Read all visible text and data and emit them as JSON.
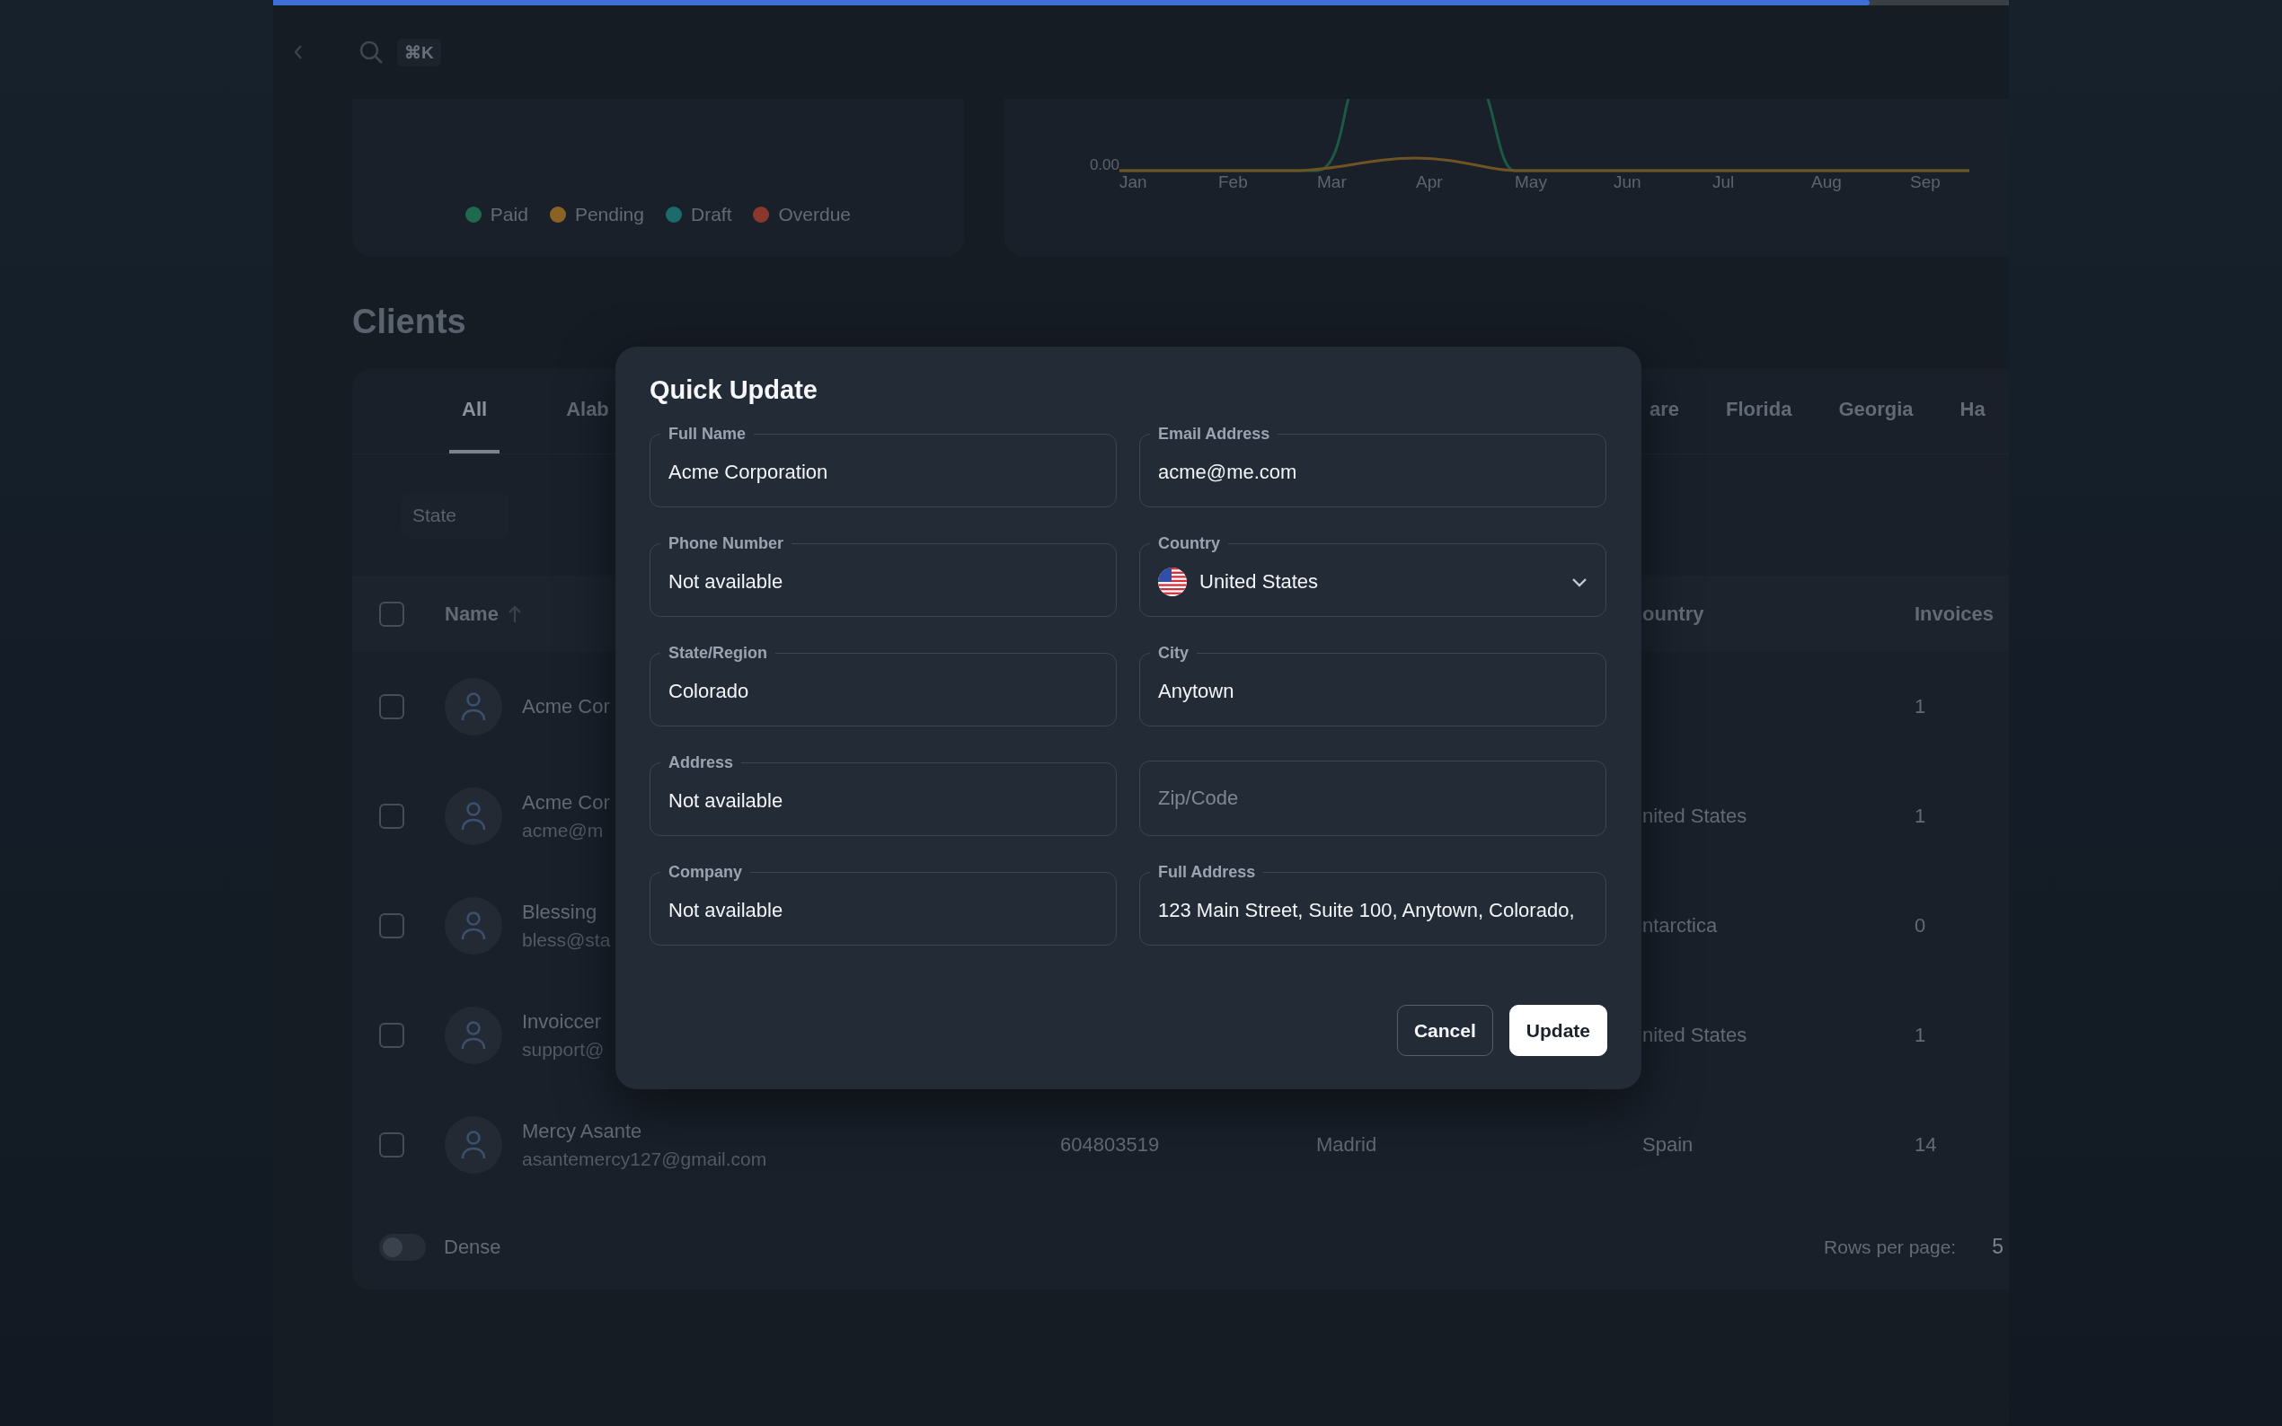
{
  "progress": {
    "level": 0.92
  },
  "topbar": {
    "shortcut": "⌘K"
  },
  "legend": [
    {
      "label": "Paid",
      "color": "#1d6a4e"
    },
    {
      "label": "Pending",
      "color": "#8a6224"
    },
    {
      "label": "Draft",
      "color": "#1d6a6a"
    },
    {
      "label": "Overdue",
      "color": "#8a372c"
    }
  ],
  "chart": {
    "y_tick": "0.00",
    "months": [
      "Jan",
      "Feb",
      "Mar",
      "Apr",
      "May",
      "Jun",
      "Jul",
      "Aug",
      "Sep"
    ]
  },
  "clients": {
    "title": "Clients",
    "tabs_left": [
      {
        "label": "All",
        "selected": true
      },
      {
        "label": "Alab",
        "selected": false
      }
    ],
    "tabs_right": [
      {
        "label": "are",
        "selected": false
      },
      {
        "label": "Florida",
        "selected": false
      },
      {
        "label": "Georgia",
        "selected": false
      },
      {
        "label": "Ha",
        "selected": false
      }
    ],
    "filter": {
      "placeholder": "State"
    },
    "header": {
      "checked": false,
      "name": "Name",
      "sorted": true,
      "country": "ountry",
      "invoices": "Invoices"
    },
    "rows": [
      {
        "checked": false,
        "name": "Acme Cor",
        "invoices": "1"
      },
      {
        "checked": false,
        "name": "Acme Cor",
        "email": "acme@m",
        "country": "nited States",
        "invoices": "1"
      },
      {
        "checked": false,
        "name": "Blessing",
        "email": "bless@sta",
        "country": "ntarctica",
        "invoices": "0"
      },
      {
        "checked": false,
        "name": "Invoiccer",
        "email": "support@",
        "country": "nited States",
        "invoices": "1"
      },
      {
        "checked": false,
        "name": "Mercy Asante",
        "email": "asantemercy127@gmail.com",
        "phone": "604803519",
        "city": "Madrid",
        "country": "Spain",
        "invoices": "14"
      }
    ],
    "dense": {
      "label": "Dense",
      "on": false
    },
    "rows_per_page": {
      "label": "Rows per page:",
      "value": "5"
    }
  },
  "dialog": {
    "title": "Quick Update",
    "fields": [
      {
        "kind": "text",
        "label": "Full Name",
        "value": "Acme Corporation"
      },
      {
        "kind": "text",
        "label": "Email Address",
        "value": "acme@me.com"
      },
      {
        "kind": "text",
        "label": "Phone Number",
        "value": "Not available"
      },
      {
        "kind": "select",
        "label": "Country",
        "value": "United States"
      },
      {
        "kind": "text",
        "label": "State/Region",
        "value": "Colorado"
      },
      {
        "kind": "text",
        "label": "City",
        "value": "Anytown"
      },
      {
        "kind": "text",
        "label": "Address",
        "value": "Not available"
      },
      {
        "kind": "text",
        "placeholder": "Zip/Code"
      },
      {
        "kind": "text",
        "label": "Company",
        "value": "Not available"
      },
      {
        "kind": "text",
        "label": "Full Address",
        "value": "123 Main Street, Suite 100, Anytown, Colorado,"
      }
    ],
    "buttons": [
      {
        "kind": "outline",
        "label": "Cancel"
      },
      {
        "kind": "primary",
        "label": "Update"
      }
    ]
  }
}
